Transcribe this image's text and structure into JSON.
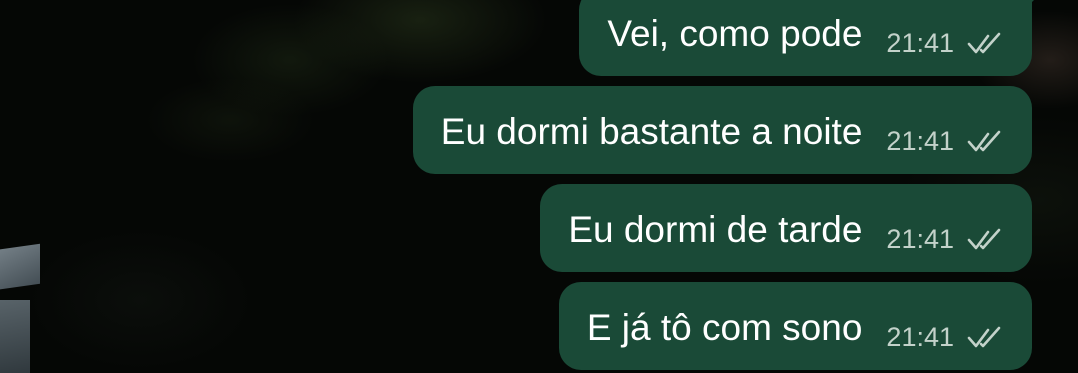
{
  "messages": [
    {
      "text": "Vei, como pode",
      "time": "21:41",
      "status_icon": "double-check-icon"
    },
    {
      "text": "Eu dormi bastante a noite",
      "time": "21:41",
      "status_icon": "double-check-icon"
    },
    {
      "text": "Eu dormi de tarde",
      "time": "21:41",
      "status_icon": "double-check-icon"
    },
    {
      "text": "E já tô com sono",
      "time": "21:41",
      "status_icon": "double-check-icon"
    }
  ],
  "colors": {
    "bubble_outgoing": "#1a4a37",
    "message_text": "#ffffff",
    "timestamp_text": "#c3d2ca",
    "tick_delivered": "#c3d2ca",
    "background": "#050705"
  }
}
